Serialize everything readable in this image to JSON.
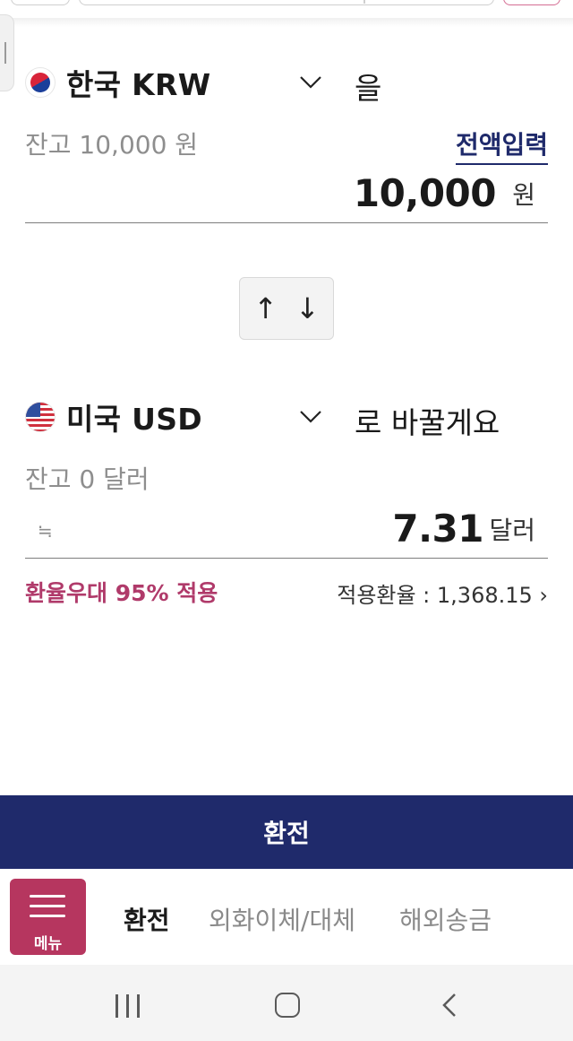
{
  "from": {
    "flag": "kr-flag-icon",
    "currency": "한국 KRW",
    "suffix": "을",
    "balance": "잔고 10,000 원",
    "full_input_label": "전액입력",
    "amount": "10,000",
    "unit": "원"
  },
  "swap": {
    "up": "↑",
    "down": "↓"
  },
  "to": {
    "flag": "us-flag-icon",
    "currency": "미국 USD",
    "suffix": "로 바꿀게요",
    "balance": "잔고 0 달러",
    "approx_symbol": "≒",
    "amount": "7.31",
    "unit": "달러"
  },
  "benefit_text": "환율우대 95% 적용",
  "applied_rate": "적용환율 : 1,368.15 ›",
  "exchange_button": "환전",
  "tabbar": {
    "menu_label": "메뉴",
    "tabs": [
      {
        "label": "환전",
        "active": true
      },
      {
        "label": "외화이체/대체",
        "active": false
      },
      {
        "label": "해외송금",
        "active": false
      }
    ]
  },
  "colors": {
    "brand_navy": "#1f2a6b",
    "brand_pink": "#b6365f",
    "benefit_pink": "#b03a6a"
  }
}
